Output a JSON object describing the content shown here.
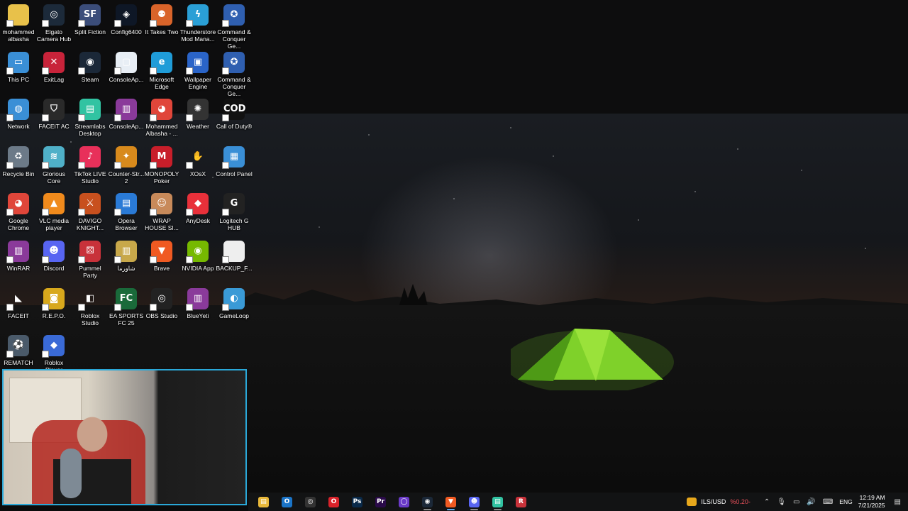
{
  "desktop": {
    "icons": [
      {
        "label": "mohammed albasha",
        "icon": "user-folder-icon",
        "bg": "#e8c14a",
        "glyph": ""
      },
      {
        "label": "Elgato Camera Hub",
        "icon": "elgato-icon",
        "bg": "#1c2a3a",
        "glyph": "◎"
      },
      {
        "label": "Split Fiction",
        "icon": "split-fiction-icon",
        "bg": "#3b4d7a",
        "glyph": "SF"
      },
      {
        "label": "Config6400",
        "icon": "config-icon",
        "bg": "#0e1726",
        "glyph": "◈"
      },
      {
        "label": "It Takes Two",
        "icon": "it-takes-two-icon",
        "bg": "#d9642a",
        "glyph": "⚉"
      },
      {
        "label": "Thunderstore Mod Mana...",
        "icon": "thunderstore-icon",
        "bg": "#2a9fd6",
        "glyph": "ϟ"
      },
      {
        "label": "Command & Conquer Ge...",
        "icon": "command-conquer-icon",
        "bg": "#2f5fb0",
        "glyph": "✪"
      },
      {
        "label": "This PC",
        "icon": "pc-icon",
        "bg": "#3a8fd6",
        "glyph": "▭"
      },
      {
        "label": "ExitLag",
        "icon": "exitlag-icon",
        "bg": "#c8233a",
        "glyph": "✕"
      },
      {
        "label": "Steam",
        "icon": "steam-icon",
        "bg": "#1b2838",
        "glyph": "◉"
      },
      {
        "label": "ConsoleAp...",
        "icon": "console-app-icon",
        "bg": "#e8eef5",
        "glyph": "▢"
      },
      {
        "label": "Microsoft Edge",
        "icon": "edge-icon",
        "bg": "#1f9cd8",
        "glyph": "e"
      },
      {
        "label": "Wallpaper Engine",
        "icon": "wallpaper-engine-icon",
        "bg": "#2a64c8",
        "glyph": "▣"
      },
      {
        "label": "Command & Conquer Ge...",
        "icon": "command-conquer-icon",
        "bg": "#2f5fb0",
        "glyph": "✪"
      },
      {
        "label": "Network",
        "icon": "network-icon",
        "bg": "#3a8fd6",
        "glyph": "◍"
      },
      {
        "label": "FACEIT AC",
        "icon": "faceit-ac-icon",
        "bg": "#2a2a2a",
        "glyph": "⛉"
      },
      {
        "label": "Streamlabs Desktop",
        "icon": "streamlabs-icon",
        "bg": "#31c3a2",
        "glyph": "▤"
      },
      {
        "label": "ConsoleAp...",
        "icon": "winrar-archive-icon",
        "bg": "#8a3a9a",
        "glyph": "▥"
      },
      {
        "label": "Mohammed Albasha - ...",
        "icon": "chrome-profile-icon",
        "bg": "#e0463a",
        "glyph": "◕"
      },
      {
        "label": "Weather",
        "icon": "weather-icon",
        "bg": "#333",
        "glyph": "✺"
      },
      {
        "label": "Call of Duty®",
        "icon": "call-of-duty-icon",
        "bg": "#111",
        "glyph": "COD"
      },
      {
        "label": "Recycle Bin",
        "icon": "recycle-bin-icon",
        "bg": "#6c7a88",
        "glyph": "♻"
      },
      {
        "label": "Glorious Core",
        "icon": "glorious-core-icon",
        "bg": "#4fb0c8",
        "glyph": "≋"
      },
      {
        "label": "TikTok LIVE Studio",
        "icon": "tiktok-icon",
        "bg": "#e8305a",
        "glyph": "♪"
      },
      {
        "label": "Counter-Str... 2",
        "icon": "counter-strike-icon",
        "bg": "#d88a1c",
        "glyph": "✦"
      },
      {
        "label": "MONOPOLY Poker",
        "icon": "monopoly-icon",
        "bg": "#c81e2a",
        "glyph": "M"
      },
      {
        "label": "XOsX",
        "icon": "xosx-icon",
        "bg": "transparent",
        "glyph": "✋"
      },
      {
        "label": "Control Panel",
        "icon": "control-panel-icon",
        "bg": "#3a8fd6",
        "glyph": "▦"
      },
      {
        "label": "Google Chrome",
        "icon": "chrome-icon",
        "bg": "#e0463a",
        "glyph": "◕"
      },
      {
        "label": "VLC media player",
        "icon": "vlc-icon",
        "bg": "#f08a1c",
        "glyph": "▲"
      },
      {
        "label": "DAVIGO KNIGHT...",
        "icon": "davigo-icon",
        "bg": "#c8501e",
        "glyph": "⚔"
      },
      {
        "label": "Opera Browser",
        "icon": "opera-browser-icon",
        "bg": "#2a7ad6",
        "glyph": "▤"
      },
      {
        "label": "WRAP HOUSE SI...",
        "icon": "wrap-house-icon",
        "bg": "#c88a5a",
        "glyph": "☺"
      },
      {
        "label": "AnyDesk",
        "icon": "anydesk-icon",
        "bg": "#e8303a",
        "glyph": "◆"
      },
      {
        "label": "Logitech G HUB",
        "icon": "logitech-icon",
        "bg": "#222",
        "glyph": "G"
      },
      {
        "label": "WinRAR",
        "icon": "winrar-icon",
        "bg": "#8a3a9a",
        "glyph": "▥"
      },
      {
        "label": "Discord",
        "icon": "discord-icon",
        "bg": "#5865f2",
        "glyph": "☻"
      },
      {
        "label": "Pummel Party",
        "icon": "pummel-party-icon",
        "bg": "#c8323a",
        "glyph": "⚄"
      },
      {
        "label": "شاورما",
        "icon": "shawarma-icon",
        "bg": "#c8a84a",
        "glyph": "▥"
      },
      {
        "label": "Brave",
        "icon": "brave-icon",
        "bg": "#f05a22",
        "glyph": "▼"
      },
      {
        "label": "NVIDIA App",
        "icon": "nvidia-icon",
        "bg": "#76b900",
        "glyph": "◉"
      },
      {
        "label": "BACKUP_F...",
        "icon": "file-icon",
        "bg": "#eeeeee",
        "glyph": ""
      },
      {
        "label": "FACEIT",
        "icon": "faceit-icon",
        "bg": "transparent",
        "glyph": "◣"
      },
      {
        "label": "R.E.P.O.",
        "icon": "repo-icon",
        "bg": "#d8a81c",
        "glyph": "◙"
      },
      {
        "label": "Roblox Studio",
        "icon": "roblox-studio-icon",
        "bg": "transparent",
        "glyph": "◧"
      },
      {
        "label": "EA SPORTS FC 25",
        "icon": "ea-sports-fc-icon",
        "bg": "#1a6a3a",
        "glyph": "FC"
      },
      {
        "label": "OBS Studio",
        "icon": "obs-icon",
        "bg": "#222",
        "glyph": "◎"
      },
      {
        "label": "BlueYeti",
        "icon": "blueyeti-icon",
        "bg": "#8a3a9a",
        "glyph": "▥"
      },
      {
        "label": "GameLoop",
        "icon": "gameloop-icon",
        "bg": "#3a9ad6",
        "glyph": "◐"
      },
      {
        "label": "REMATCH",
        "icon": "rematch-icon",
        "bg": "#4a5a6a",
        "glyph": "⚽"
      },
      {
        "label": "Roblox Player",
        "icon": "roblox-player-icon",
        "bg": "#3a6ad6",
        "glyph": "◆"
      }
    ]
  },
  "taskbar": {
    "apps": [
      {
        "icon": "file-explorer-icon",
        "bg": "#e8b83a",
        "glyph": "▤",
        "running": false
      },
      {
        "icon": "outlook-icon",
        "bg": "#1a74c8",
        "glyph": "O",
        "running": false
      },
      {
        "icon": "obs-icon",
        "bg": "#333",
        "glyph": "◎",
        "running": false
      },
      {
        "icon": "opera-icon",
        "bg": "#d8222a",
        "glyph": "O",
        "running": false
      },
      {
        "icon": "photoshop-icon",
        "bg": "#0a2a4a",
        "glyph": "Ps",
        "running": false
      },
      {
        "icon": "premiere-icon",
        "bg": "#2a0a4a",
        "glyph": "Pr",
        "running": false
      },
      {
        "icon": "search-app-icon",
        "bg": "#6a3ac8",
        "glyph": "◯",
        "running": false
      },
      {
        "icon": "steam-icon",
        "bg": "#1b2838",
        "glyph": "◉",
        "running": true
      },
      {
        "icon": "brave-icon",
        "bg": "#f05a22",
        "glyph": "▼",
        "running": true,
        "active": true
      },
      {
        "icon": "discord-icon",
        "bg": "#5865f2",
        "glyph": "☻",
        "running": true
      },
      {
        "icon": "streamlabs-icon",
        "bg": "#31c3a2",
        "glyph": "▤",
        "running": true
      },
      {
        "icon": "red-app-icon",
        "bg": "#c8323a",
        "glyph": "R",
        "running": false
      }
    ],
    "tray": {
      "currency_label": "ILS/USD",
      "currency_change": "%0.20-",
      "currency_change_color": "#e8505a",
      "language": "ENG",
      "time": "12:19 AM",
      "date": "7/21/2025"
    }
  }
}
